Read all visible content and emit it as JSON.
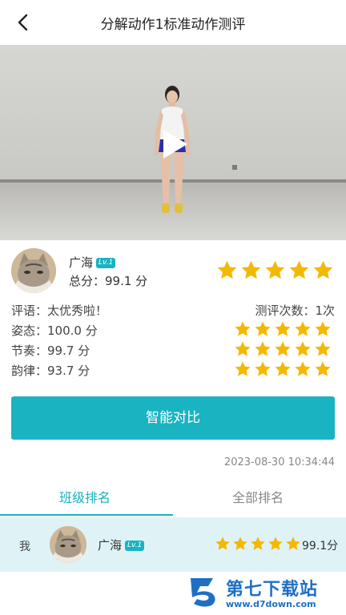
{
  "header": {
    "title": "分解动作1标准动作测评"
  },
  "user": {
    "name": "广海",
    "level": "Lv.1",
    "total_score": "总分：99.1 分",
    "rating": 5
  },
  "evaluation": {
    "comment": "评语：太优秀啦！",
    "count": "测评次数：1次",
    "metrics": [
      {
        "label": "姿态：100.0 分",
        "stars": 5
      },
      {
        "label": "节奏：99.7 分",
        "stars": 5
      },
      {
        "label": "韵律：93.7 分",
        "stars": 5
      }
    ]
  },
  "actions": {
    "compare_label": "智能对比"
  },
  "timestamp": "2023-08-30 10:34:44",
  "tabs": [
    {
      "label": "班级排名",
      "active": true
    },
    {
      "label": "全部排名",
      "active": false
    }
  ],
  "ranking": {
    "me_label": "我",
    "name": "广海",
    "level": "Lv.1",
    "stars": 5,
    "score": "99.1分"
  },
  "watermark": {
    "text": "第七下载站",
    "url": "www.d7down.com"
  },
  "colors": {
    "accent": "#19b3c1",
    "star": "#f5b800"
  }
}
